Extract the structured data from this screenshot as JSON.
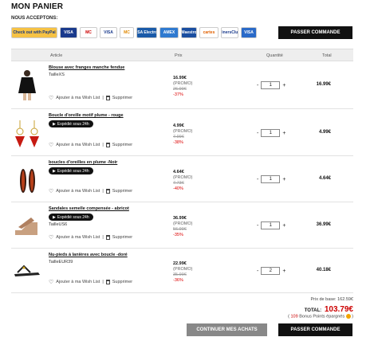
{
  "page_title": "MON PANIER",
  "accepted_label": "NOUS ACCEPTONS:",
  "payment_methods": [
    {
      "label": "Check out with PayPal",
      "color": "#f6c244",
      "text_color": "#1a3a80"
    },
    {
      "label": "VISA",
      "color": "#1a3a8c",
      "text_color": "#ffffff"
    },
    {
      "label": "MC",
      "color": "#ffffff",
      "text_color": "#cc0000"
    },
    {
      "label": "VISA",
      "color": "#ffffff",
      "text_color": "#1a3a8c"
    },
    {
      "label": "MC",
      "color": "#ffffff",
      "text_color": "#e08800"
    },
    {
      "label": "VISA Electron",
      "color": "#1a5aa8",
      "text_color": "#ffffff"
    },
    {
      "label": "AMEX",
      "color": "#2f7ad0",
      "text_color": "#ffffff"
    },
    {
      "label": "Maestro",
      "color": "#1a4ea0",
      "text_color": "#ffffff"
    },
    {
      "label": "cartes",
      "color": "#ffffff",
      "text_color": "#e06000"
    },
    {
      "label": "DinersClub",
      "color": "#ffffff",
      "text_color": "#1a3a8c"
    },
    {
      "label": "VISA",
      "color": "#2a6ac8",
      "text_color": "#ffffff"
    }
  ],
  "checkout_label": "PASSER COMMANDE",
  "table_headers": {
    "article": "Article",
    "price": "Prix",
    "quantity": "Quantité",
    "total": "Total"
  },
  "actions": {
    "wishlist": "Ajouter à ma Wish List",
    "separator": "|",
    "delete": "Supprimer"
  },
  "qty_minus": "-",
  "qty_plus": "+",
  "items": [
    {
      "name": "Blouse avec franges manche fendue",
      "shipping": "",
      "size": "TailleXS",
      "price": "16.99€",
      "promo": "(PROMO)",
      "old_price": "26.99€",
      "discount": "-37%",
      "quantity": "1",
      "total": "16.99€",
      "icon": "blouse-image"
    },
    {
      "name": "Boucle d'oreille motif plume - rouge",
      "shipping": "Expédié sous 24h",
      "size": "",
      "price": "4.99€",
      "promo": "(PROMO)",
      "old_price": "7.99€",
      "discount": "-38%",
      "quantity": "1",
      "total": "4.99€",
      "icon": "red-earring-image"
    },
    {
      "name": "boucles d'oreilles en plume -Noir",
      "shipping": "Expédié sous 24h",
      "size": "",
      "price": "4.64€",
      "promo": "(PROMO)",
      "old_price": "7.73€",
      "discount": "-40%",
      "quantity": "1",
      "total": "4.64€",
      "icon": "feather-earring-image"
    },
    {
      "name": "Sandales semelle compensée - abricot",
      "shipping": "Expédié sous 24h",
      "size": "TailleUS6",
      "price": "36.99€",
      "promo": "(PROMO)",
      "old_price": "56.99€",
      "discount": "-35%",
      "quantity": "1",
      "total": "36.99€",
      "icon": "wedge-sandal-image"
    },
    {
      "name": "Nu-pieds à lanières avec boucle -doré",
      "shipping": "",
      "size": "TailleEUR39",
      "price": "22.99€",
      "promo": "(PROMO)",
      "old_price": "35.99€",
      "discount": "-36%",
      "quantity": "2",
      "total": "40.18€",
      "icon": "flat-sandal-image"
    }
  ],
  "summary": {
    "base_price": "Prix de base: 162.59€",
    "total_label": "TOTAL:",
    "total_amount": "103.79€",
    "bonus_prefix": "(",
    "bonus_points": "109",
    "bonus_text": "Bonus Points épargnés",
    "bonus_suffix": ")"
  },
  "continue_label": "CONTINUER MES ACHATS"
}
